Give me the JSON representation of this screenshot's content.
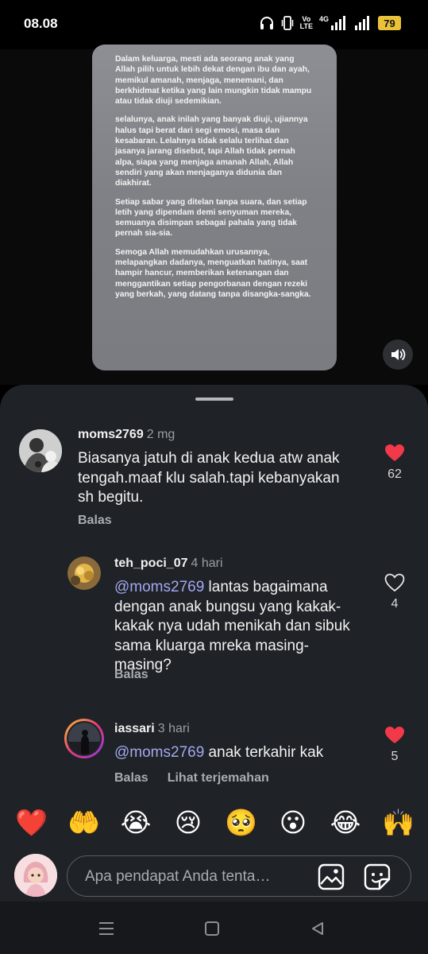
{
  "status_bar": {
    "time": "08.08",
    "lte_top": "Vo",
    "lte_bottom": "LTE",
    "network": "4G",
    "battery": "79"
  },
  "story": {
    "paragraphs": [
      "Dalam keluarga, mesti ada seorang anak yang Allah pilih untuk lebih dekat dengan ibu dan ayah, memikul amanah, menjaga, menemani, dan berkhidmat ketika yang lain mungkin tidak mampu atau tidak diuji sedemikian.",
      "selalunya, anak inilah yang banyak diuji, ujiannya halus tapi berat dari segi emosi, masa dan kesabaran. Lelahnya tidak selalu terlihat dan jasanya jarang disebut, tapi Allah tidak pernah alpa, siapa yang menjaga amanah Allah, Allah sendiri yang akan menjaganya didunia dan diakhirat.",
      "Setiap sabar yang ditelan tanpa suara, dan setiap letih yang dipendam demi senyuman mereka, semuanya disimpan sebagai pahala yang tidak pernah sia-sia.",
      "Semoga Allah memudahkan urusannya, melapangkan dadanya, menguatkan hatinya, saat hampir hancur, memberikan ketenangan dan menggantikan setiap pengorbanan dengan rezeki yang berkah, yang datang tanpa disangka-sangka."
    ]
  },
  "comments": [
    {
      "username": "moms2769",
      "time": "2 mg",
      "mention": "",
      "text": "Biasanya jatuh di anak kedua atw anak tengah.maaf klu salah.tapi kebanyakan sh begitu.",
      "reply_label": "Balas",
      "translate_label": "",
      "likes": "62",
      "liked": true
    },
    {
      "username": "teh_poci_07",
      "time": "4 hari",
      "mention": "@moms2769",
      "text": " lantas bagaimana dengan anak bungsu yang kakak-kakak nya udah menikah dan sibuk sama kluarga mreka masing-masing?",
      "reply_label": "Balas",
      "translate_label": "",
      "likes": "4",
      "liked": false
    },
    {
      "username": "iassari",
      "time": "3 hari",
      "mention": "@moms2769",
      "text": " anak terkahir kak",
      "reply_label": "Balas",
      "translate_label": "Lihat terjemahan",
      "likes": "5",
      "liked": true
    }
  ],
  "emoji_bar": [
    "❤️",
    "🤲",
    "😭",
    "😢",
    "🥺",
    "😮",
    "😂",
    "🙌"
  ],
  "comment_input": {
    "placeholder": "Apa pendapat Anda tenta…"
  },
  "colors": {
    "sheet_bg": "#1f2226",
    "heart_red": "#f2394a",
    "mention": "#a3a8f0",
    "battery": "#e9c23a"
  },
  "icons": {
    "volume": "speaker-icon",
    "gallery": "image-icon",
    "sticker": "sticker-icon",
    "nav": [
      "menu-icon",
      "home-square-icon",
      "back-triangle-icon"
    ]
  }
}
